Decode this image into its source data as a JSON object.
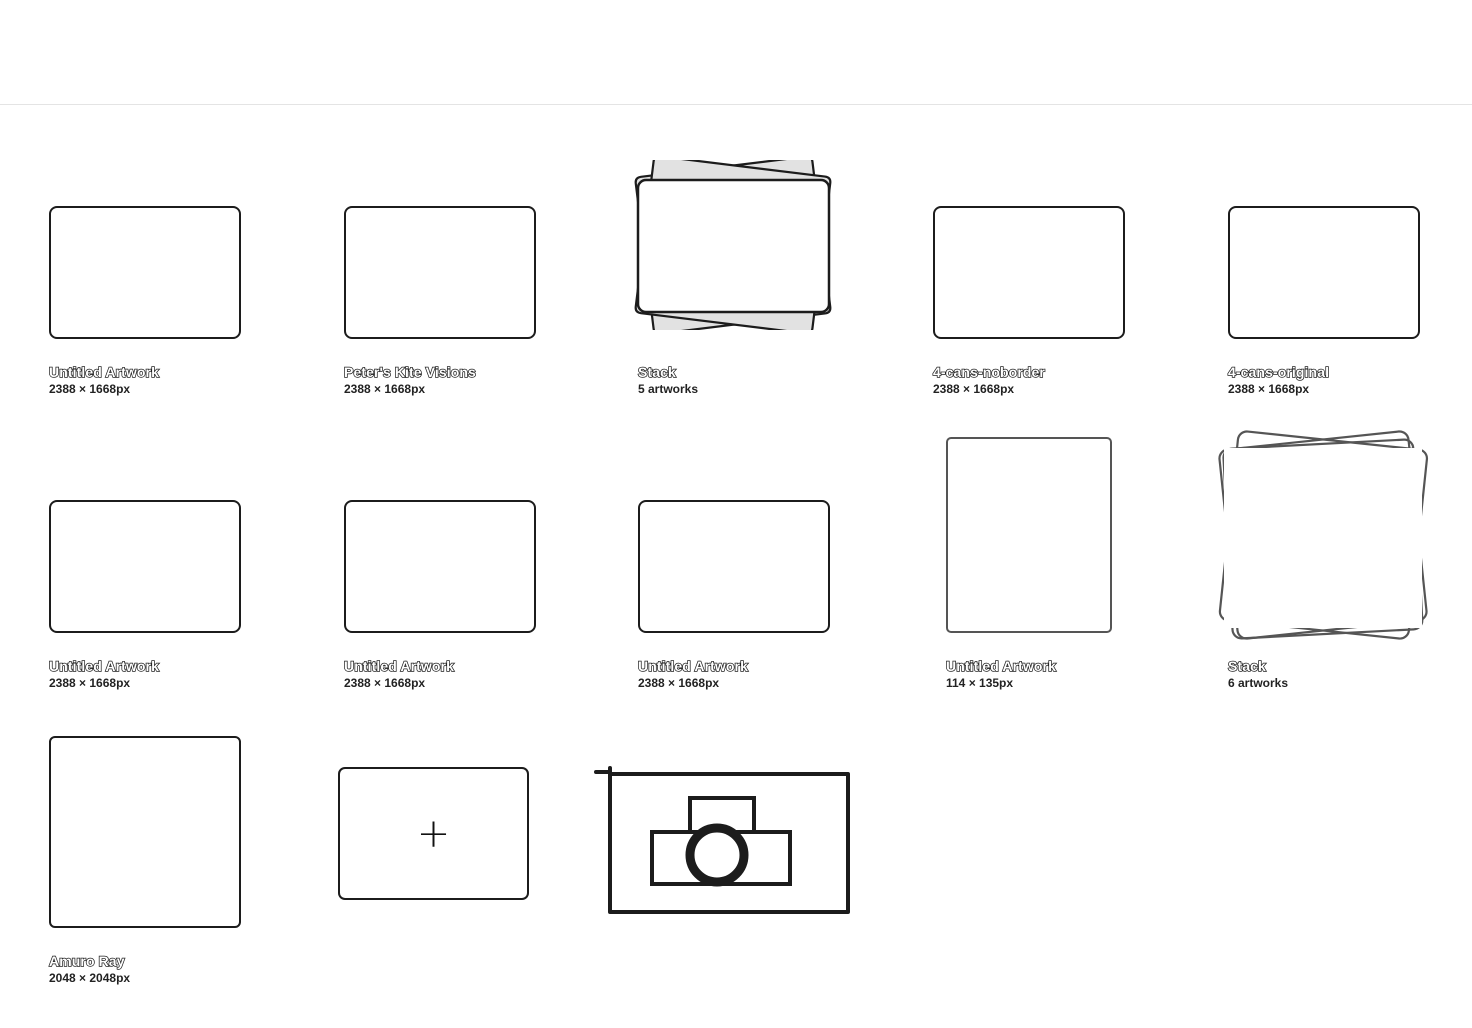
{
  "gallery": {
    "items": [
      {
        "name": "Untitled Artwork",
        "sub": "2388 × 1668px"
      },
      {
        "name": "Peter's Kite Visions",
        "sub": "2388 × 1668px"
      },
      {
        "name": "Stack",
        "sub": "5 artworks"
      },
      {
        "name": "4-cans-noborder",
        "sub": "2388 × 1668px"
      },
      {
        "name": "4-cans-original",
        "sub": "2388 × 1668px"
      },
      {
        "name": "Untitled Artwork",
        "sub": "2388 × 1668px"
      },
      {
        "name": "Untitled Artwork",
        "sub": "2388 × 1668px"
      },
      {
        "name": "Untitled Artwork",
        "sub": "2388 × 1668px"
      },
      {
        "name": "Untitled Artwork",
        "sub": "114 × 135px"
      },
      {
        "name": "Stack",
        "sub": "6 artworks"
      },
      {
        "name": "Amuro Ray",
        "sub": "2048 × 2048px"
      }
    ],
    "new_canvas_icon": "plus-icon",
    "import_photo_icon": "camera-icon"
  }
}
